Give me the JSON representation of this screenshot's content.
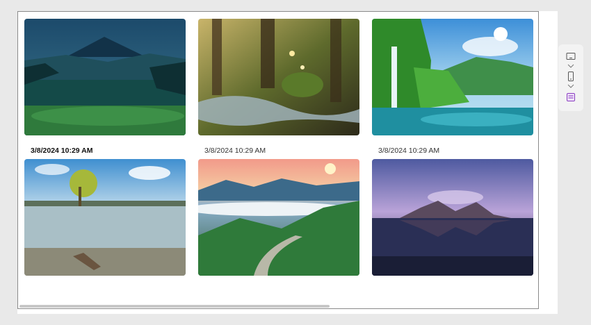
{
  "gallery": {
    "items": [
      {
        "timestamp": "",
        "image": "volcano-night-landscape"
      },
      {
        "timestamp": "",
        "image": "forest-stream"
      },
      {
        "timestamp": "",
        "image": "waterfall-lagoon"
      },
      {
        "timestamp": "3/8/2024 10:29 AM",
        "image": "lake-tree"
      },
      {
        "timestamp": "3/8/2024 10:29 AM",
        "image": "mountain-path-sunset"
      },
      {
        "timestamp": "3/8/2024 10:29 AM",
        "image": "mountain-reflection-beach"
      }
    ],
    "selected_index": 3,
    "horizontal_scroll_position": 0.0
  },
  "screen_panel": {
    "icons": [
      "tablet-landscape-icon",
      "chevron-down-icon",
      "phone-portrait-icon",
      "chevron-down-icon",
      "layout-icon"
    ],
    "accent_color": "#8a3cc2"
  }
}
